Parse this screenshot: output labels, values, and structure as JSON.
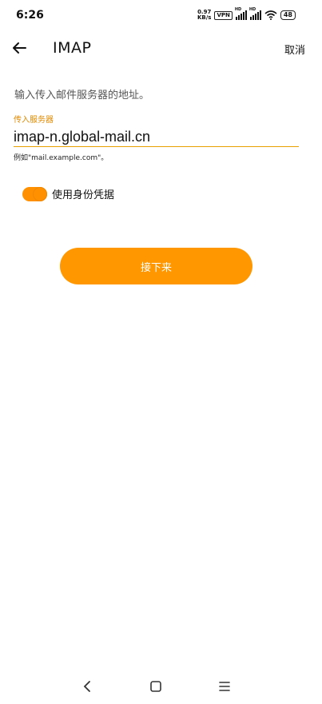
{
  "status_bar": {
    "time": "6:26",
    "net_speed_value": "0.97",
    "net_speed_unit": "KB/s",
    "vpn_label": "VPN",
    "signal_hd_label": "HD",
    "battery": "48",
    "icons": [
      "signal-icon",
      "signal-icon",
      "wifi-icon",
      "battery-icon"
    ]
  },
  "header": {
    "title": "IMAP",
    "cancel_label": "取消",
    "back_icon": "arrow-left-icon"
  },
  "form": {
    "instruction": "输入传入邮件服务器的地址。",
    "server_label": "传入服务器",
    "server_value": "imap-n.global-mail.cn",
    "server_hint": "例如\"mail.example.com\"。",
    "credentials_label": "使用身份凭据",
    "credentials_enabled": true,
    "next_label": "接下来"
  },
  "colors": {
    "accent": "#ff9800",
    "label_accent": "#e08a00"
  },
  "nav_bar": {
    "icons": [
      "back-icon",
      "home-icon",
      "menu-icon"
    ]
  }
}
